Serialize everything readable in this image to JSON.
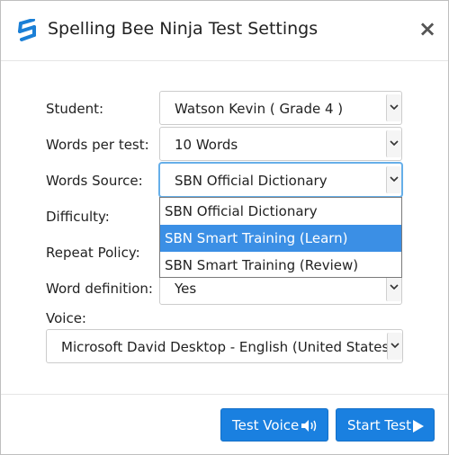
{
  "dialog": {
    "title": "Spelling Bee Ninja Test Settings",
    "close_label": "×"
  },
  "form": {
    "student_label": "Student:",
    "student_value": "Watson Kevin ( Grade 4 )",
    "words_label": "Words per test:",
    "words_value": "10 Words",
    "source_label": "Words Source:",
    "source_value": "SBN Official Dictionary",
    "difficulty_label": "Difficulty:",
    "repeat_label": "Repeat Policy:",
    "definition_label": "Word definition:",
    "definition_value": "Yes",
    "voice_label": "Voice:",
    "voice_value": "Microsoft David Desktop - English (United States)"
  },
  "source_dropdown": {
    "options": [
      "SBN Official Dictionary",
      "SBN Smart Training (Learn)",
      "SBN Smart Training (Review)"
    ],
    "highlighted": "SBN Smart Training (Learn)"
  },
  "footer": {
    "test_voice_label": "Test Voice",
    "start_test_label": "Start Test"
  },
  "colors": {
    "primary_button": "#1a80e0",
    "highlight": "#3b8fe5",
    "logo_blue": "#1a7fd6"
  },
  "icons": [
    "sbn-logo-icon",
    "close-icon",
    "chevron-down-icon",
    "speaker-icon",
    "play-icon"
  ]
}
